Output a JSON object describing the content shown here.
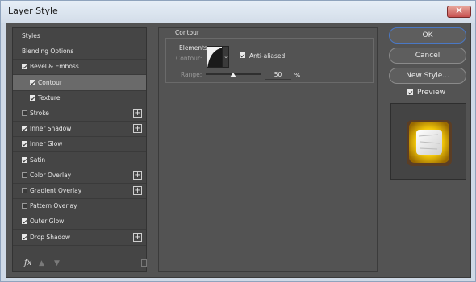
{
  "window": {
    "title": "Layer Style"
  },
  "sidebar": {
    "items": [
      {
        "label": "Styles",
        "checkbox": false,
        "checked": false,
        "plus": false,
        "selected": false
      },
      {
        "label": "Blending Options",
        "checkbox": false,
        "checked": false,
        "plus": false,
        "selected": false
      },
      {
        "label": "Bevel & Emboss",
        "checkbox": true,
        "checked": true,
        "plus": false,
        "selected": false
      },
      {
        "label": "Contour",
        "checkbox": true,
        "checked": true,
        "plus": false,
        "selected": true
      },
      {
        "label": "Texture",
        "checkbox": true,
        "checked": true,
        "plus": false,
        "selected": false
      },
      {
        "label": "Stroke",
        "checkbox": true,
        "checked": false,
        "plus": true,
        "selected": false
      },
      {
        "label": "Inner Shadow",
        "checkbox": true,
        "checked": true,
        "plus": true,
        "selected": false
      },
      {
        "label": "Inner Glow",
        "checkbox": true,
        "checked": true,
        "plus": false,
        "selected": false
      },
      {
        "label": "Satin",
        "checkbox": true,
        "checked": true,
        "plus": false,
        "selected": false
      },
      {
        "label": "Color Overlay",
        "checkbox": true,
        "checked": false,
        "plus": true,
        "selected": false
      },
      {
        "label": "Gradient Overlay",
        "checkbox": true,
        "checked": false,
        "plus": true,
        "selected": false
      },
      {
        "label": "Pattern Overlay",
        "checkbox": true,
        "checked": false,
        "plus": false,
        "selected": false
      },
      {
        "label": "Outer Glow",
        "checkbox": true,
        "checked": true,
        "plus": false,
        "selected": false
      },
      {
        "label": "Drop Shadow",
        "checkbox": true,
        "checked": true,
        "plus": true,
        "selected": false
      }
    ],
    "bottom": {
      "fx_label": "fx",
      "up_icon": "arrow-up-icon",
      "down_icon": "arrow-down-icon",
      "delete_icon": "trash-icon"
    }
  },
  "contour_panel": {
    "title": "Contour",
    "group_title": "Elements",
    "contour_label": "Contour:",
    "anti_aliased_label": "Anti-aliased",
    "anti_aliased_checked": true,
    "range_label": "Range:",
    "range_value": "50",
    "range_unit": "%",
    "range_fraction": 0.5
  },
  "buttons": {
    "ok": "OK",
    "cancel": "Cancel",
    "new_style": "New Style..."
  },
  "preview": {
    "label": "Preview",
    "checked": true
  },
  "colors": {
    "panel_bg": "#535353",
    "sidebar_bg": "#454545",
    "selected_row": "#6a6a6a",
    "ok_border": "#4a78c5",
    "close_red": "#c75050",
    "preview_gold": "#f2c70a"
  }
}
